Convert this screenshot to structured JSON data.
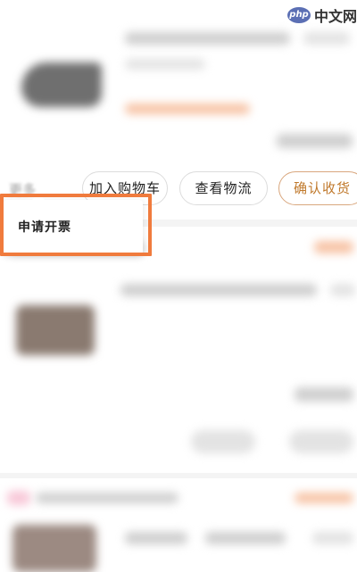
{
  "watermark": {
    "logo": "php",
    "text": "中文网"
  },
  "actions": {
    "more": "更多",
    "add_to_cart": "加入购物车",
    "view_logistics": "查看物流",
    "confirm_receipt": "确认收货"
  },
  "popup": {
    "apply_invoice": "申请开票"
  },
  "colors": {
    "highlight_border": "#f07b3d",
    "confirm_text": "#c0792c",
    "confirm_border": "#d9a77e"
  }
}
